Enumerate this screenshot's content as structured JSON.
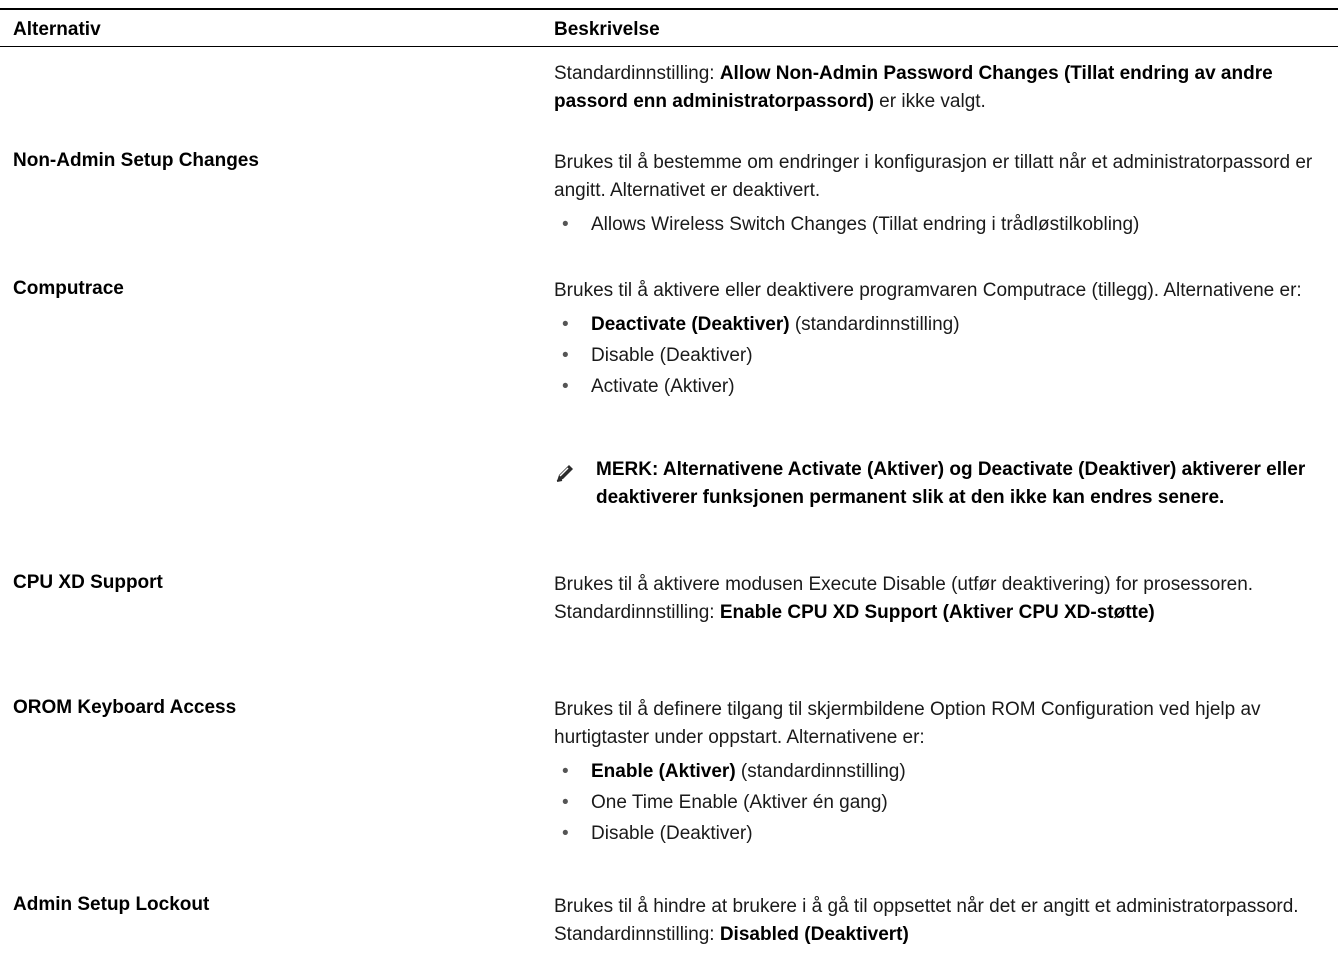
{
  "header": {
    "col_option": "Alternativ",
    "col_description": "Beskrivelse"
  },
  "row_password": {
    "prefix": "Standardinnstilling: ",
    "bold": "Allow Non-Admin Password Changes (Tillat endring av andre passord enn administratorpassord)",
    "suffix": " er ikke valgt."
  },
  "row_nonadmin": {
    "option": "Non-Admin Setup Changes",
    "text": "Brukes til å bestemme om endringer i konfigurasjon er tillatt når et administratorpassord er angitt. Alternativet er deaktivert.",
    "items": [
      "Allows Wireless Switch Changes (Tillat endring i trådløstilkobling)"
    ]
  },
  "row_computrace": {
    "option": "Computrace",
    "text": "Brukes til å aktivere eller deaktivere programvaren Computrace (tillegg). Alternativene er:",
    "item1_bold": "Deactivate (Deaktiver)",
    "item1_rest": " (standardinnstilling)",
    "item2": "Disable (Deaktiver)",
    "item3": "Activate (Aktiver)",
    "note": "MERK: Alternativene Activate (Aktiver) og Deactivate (Deaktiver) aktiverer eller deaktiverer funksjonen permanent slik at den ikke kan endres senere."
  },
  "row_cpuxd": {
    "option": "CPU XD Support",
    "text": "Brukes til å aktivere modusen Execute Disable (utfør deaktivering) for prosessoren.",
    "default_prefix": "Standardinnstilling: ",
    "default_bold": "Enable CPU XD Support (Aktiver CPU XD-støtte)"
  },
  "row_orom": {
    "option": "OROM Keyboard Access",
    "text": "Brukes til å definere tilgang til skjermbildene Option ROM Configuration ved hjelp av hurtigtaster under oppstart. Alternativene er:",
    "item1_bold": "Enable (Aktiver)",
    "item1_rest": " (standardinnstilling)",
    "item2": "One Time Enable (Aktiver én gang)",
    "item3": "Disable (Deaktiver)"
  },
  "row_admin": {
    "option": "Admin Setup Lockout",
    "text": "Brukes til å hindre at brukere i å gå til oppsettet når det er angitt et administratorpassord.",
    "default_prefix": "Standardinnstilling: ",
    "default_bold": "Disabled (Deaktivert)"
  },
  "icons": {
    "note": "pencil-note-icon",
    "bullet": "•"
  }
}
